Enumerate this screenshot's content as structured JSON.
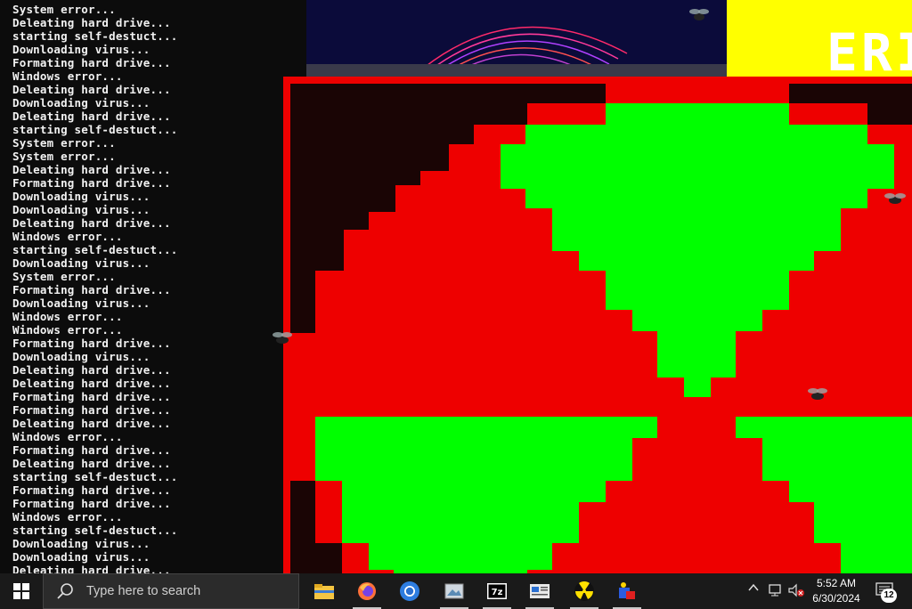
{
  "console": {
    "lines": [
      "System error...",
      "Deleating hard drive...",
      "starting self-destuct...",
      "Downloading virus...",
      "Formating hard drive...",
      "Windows error...",
      "Deleating hard drive...",
      "Downloading virus...",
      "Deleating hard drive...",
      "starting self-destuct...",
      "System error...",
      "System error...",
      "Deleating hard drive...",
      "Formating hard drive...",
      "Downloading virus...",
      "Downloading virus...",
      "Deleating hard drive...",
      "Windows error...",
      "starting self-destuct...",
      "Downloading virus...",
      "System error...",
      "Formating hard drive...",
      "Downloading virus...",
      "Windows error...",
      "Windows error...",
      "Formating hard drive...",
      "Downloading virus...",
      "Deleating hard drive...",
      "Deleating hard drive...",
      "Formating hard drive...",
      "Formating hard drive...",
      "Deleating hard drive...",
      "Windows error...",
      "Formating hard drive...",
      "Deleating hard drive...",
      "starting self-destuct...",
      "Formating hard drive...",
      "Formating hard drive...",
      "Windows error...",
      "starting self-destuct...",
      "Downloading virus...",
      "Downloading virus...",
      "Deleating hard drive..."
    ]
  },
  "banner": {
    "text": "ERI",
    "bg": "#ffff00"
  },
  "colors": {
    "red": "#ee0000",
    "green": "#00ff00",
    "dark": "#1a0505"
  },
  "taskbar": {
    "search_placeholder": "Type here to search",
    "apps": [
      "file-explorer-icon",
      "firefox-icon",
      "chrome-icon",
      "photo-app-icon",
      "7zip-icon",
      "news-app-icon",
      "radiation-icon",
      "paint-app-icon"
    ],
    "time": "5:52 AM",
    "date": "6/30/2024",
    "notification_count": "12"
  }
}
